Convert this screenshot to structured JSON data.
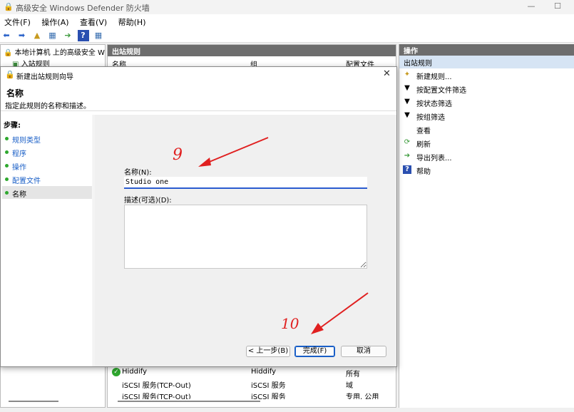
{
  "window": {
    "title": "高级安全 Windows Defender 防火墙",
    "minimize": "—",
    "maximize": "☐"
  },
  "menu": [
    "文件(F)",
    "操作(A)",
    "查看(V)",
    "帮助(H)"
  ],
  "tree": {
    "root": "本地计算机 上的高级安全 Win",
    "inbound": "入站规则"
  },
  "center": {
    "header": "出站规则",
    "columns": [
      "名称",
      "组",
      "配置文件"
    ],
    "rows": [
      {
        "name": "Hiddify",
        "group": "Hiddify",
        "profile": "所有"
      },
      {
        "name": "iSCSI 服务(TCP-Out)",
        "group": "iSCSI 服务",
        "profile": "域"
      },
      {
        "name": "iSCSI 服务(TCP-Out)",
        "group": "iSCSI 服务",
        "profile": "专用, 公用"
      }
    ]
  },
  "actions": {
    "header": "操作",
    "section": "出站规则",
    "items": [
      {
        "label": "新建规则...",
        "icon": "new-rule-icon"
      },
      {
        "label": "按配置文件筛选",
        "icon": "filter-icon"
      },
      {
        "label": "按状态筛选",
        "icon": "filter-icon"
      },
      {
        "label": "按组筛选",
        "icon": "filter-icon"
      },
      {
        "label": "查看",
        "icon": ""
      },
      {
        "label": "刷新",
        "icon": "refresh-icon"
      },
      {
        "label": "导出列表...",
        "icon": "export-icon"
      },
      {
        "label": "帮助",
        "icon": "help-icon"
      }
    ]
  },
  "wizard": {
    "title": "新建出站规则向导",
    "heading": "名称",
    "subheading": "指定此规则的名称和描述。",
    "steps_title": "步骤:",
    "steps": [
      "规则类型",
      "程序",
      "操作",
      "配置文件",
      "名称"
    ],
    "name_label": "名称(N):",
    "name_value": "Studio one",
    "desc_label": "描述(可选)(D):",
    "desc_value": "",
    "back": "< 上一步(B)",
    "finish": "完成(F)",
    "cancel": "取消"
  },
  "annotations": {
    "step9": "9",
    "step10": "10"
  },
  "colors": {
    "annotation": "#e02020",
    "accent": "#2a5bd0",
    "step_dot": "#2ea82e",
    "pane_header": "#6d6d6d"
  }
}
